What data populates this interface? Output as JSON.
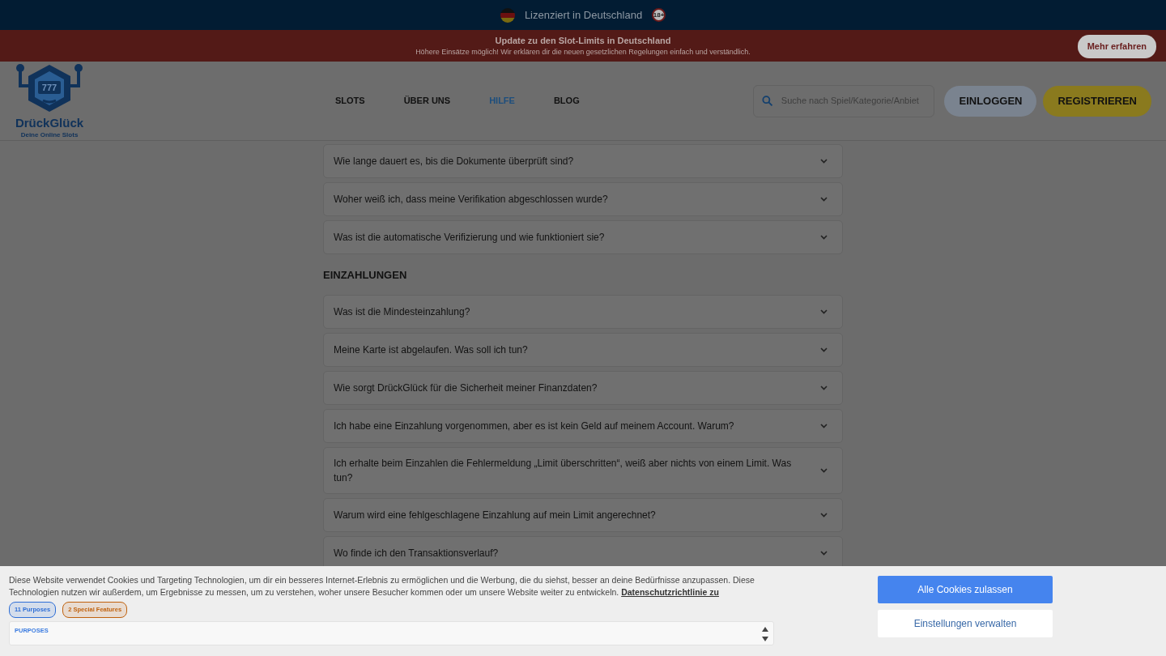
{
  "license_bar": {
    "text": "Lizenziert in Deutschland",
    "age_badge": "18+"
  },
  "notice": {
    "title": "Update zu den Slot-Limits in Deutschland",
    "text": "Höhere Einsätze möglich! Wir erklären dir die neuen gesetzlichen Regelungen einfach und verständlich.",
    "button": "Mehr erfahren"
  },
  "logo": {
    "reels": "777",
    "name": "DrückGlück",
    "tagline": "Deine Online Slots"
  },
  "nav": [
    {
      "label": "SLOTS",
      "selected": false
    },
    {
      "label": "ÜBER UNS",
      "selected": false
    },
    {
      "label": "HILFE",
      "selected": true
    },
    {
      "label": "BLOG",
      "selected": false
    }
  ],
  "search": {
    "placeholder": "Suche nach Spiel/Kategorie/Anbiet"
  },
  "buttons": [
    {
      "label": "EINLOGGEN",
      "kind": "login"
    },
    {
      "label": "REGISTRIEREN",
      "kind": "register"
    }
  ],
  "faq": [
    {
      "kind": "question",
      "text": "Wie lange dauert es, bis die Dokumente überprüft sind?"
    },
    {
      "kind": "question",
      "text": "Woher weiß ich, dass meine Verifikation abgeschlossen wurde?"
    },
    {
      "kind": "question",
      "text": "Was ist die automatische Verifizierung und wie funktioniert sie?"
    },
    {
      "kind": "heading",
      "text": "EINZAHLUNGEN"
    },
    {
      "kind": "question",
      "text": "Was ist die Mindesteinzahlung?"
    },
    {
      "kind": "question",
      "text": "Meine Karte ist abgelaufen. Was soll ich tun?"
    },
    {
      "kind": "question",
      "text": "Wie sorgt DrückGlück für die Sicherheit meiner Finanzdaten?"
    },
    {
      "kind": "question",
      "text": "Ich habe eine Einzahlung vorgenommen, aber es ist kein Geld auf meinem Account. Warum?"
    },
    {
      "kind": "question",
      "text": "Ich erhalte beim Einzahlen die Fehlermeldung „Limit überschritten“, weiß aber nichts von einem Limit. Was tun?"
    },
    {
      "kind": "question",
      "text": "Warum wird eine fehlgeschlagene Einzahlung auf mein Limit angerechnet?"
    },
    {
      "kind": "question",
      "text": "Wo finde ich den Transaktionsverlauf?"
    }
  ],
  "cookie_banner": {
    "text": "Diese Website verwendet Cookies und Targeting Technologien, um dir ein besseres Internet-Erlebnis zu ermöglichen und die Werbung, die du siehst, besser an deine Bedürfnisse anzupassen. Diese Technologien nutzen wir außerdem, um Ergebnisse zu messen, um zu verstehen, woher unsere Besucher kommen oder um unsere Website weiter zu entwickeln.",
    "link": "Datenschutzrichtlinie zu",
    "tags": [
      {
        "label": "11 Purposes",
        "color": "#2f6fd6"
      },
      {
        "label": "2 Special Features",
        "color": "#c0620e"
      }
    ],
    "purposes_title": "PURPOSES",
    "buttons": [
      {
        "label": "Alle Cookies zulassen",
        "kind": "primary"
      },
      {
        "label": "Einstellungen verwalten",
        "kind": "secondary"
      }
    ]
  }
}
